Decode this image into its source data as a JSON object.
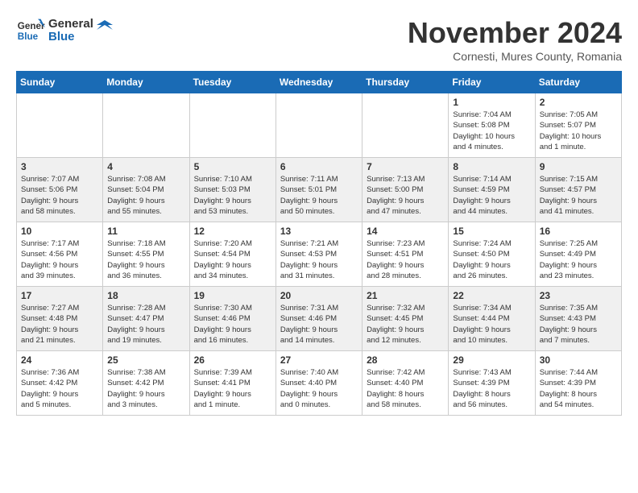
{
  "header": {
    "logo_line1": "General",
    "logo_line2": "Blue",
    "month_title": "November 2024",
    "subtitle": "Cornesti, Mures County, Romania"
  },
  "weekdays": [
    "Sunday",
    "Monday",
    "Tuesday",
    "Wednesday",
    "Thursday",
    "Friday",
    "Saturday"
  ],
  "weeks": [
    [
      {
        "day": "",
        "info": ""
      },
      {
        "day": "",
        "info": ""
      },
      {
        "day": "",
        "info": ""
      },
      {
        "day": "",
        "info": ""
      },
      {
        "day": "",
        "info": ""
      },
      {
        "day": "1",
        "info": "Sunrise: 7:04 AM\nSunset: 5:08 PM\nDaylight: 10 hours\nand 4 minutes."
      },
      {
        "day": "2",
        "info": "Sunrise: 7:05 AM\nSunset: 5:07 PM\nDaylight: 10 hours\nand 1 minute."
      }
    ],
    [
      {
        "day": "3",
        "info": "Sunrise: 7:07 AM\nSunset: 5:06 PM\nDaylight: 9 hours\nand 58 minutes."
      },
      {
        "day": "4",
        "info": "Sunrise: 7:08 AM\nSunset: 5:04 PM\nDaylight: 9 hours\nand 55 minutes."
      },
      {
        "day": "5",
        "info": "Sunrise: 7:10 AM\nSunset: 5:03 PM\nDaylight: 9 hours\nand 53 minutes."
      },
      {
        "day": "6",
        "info": "Sunrise: 7:11 AM\nSunset: 5:01 PM\nDaylight: 9 hours\nand 50 minutes."
      },
      {
        "day": "7",
        "info": "Sunrise: 7:13 AM\nSunset: 5:00 PM\nDaylight: 9 hours\nand 47 minutes."
      },
      {
        "day": "8",
        "info": "Sunrise: 7:14 AM\nSunset: 4:59 PM\nDaylight: 9 hours\nand 44 minutes."
      },
      {
        "day": "9",
        "info": "Sunrise: 7:15 AM\nSunset: 4:57 PM\nDaylight: 9 hours\nand 41 minutes."
      }
    ],
    [
      {
        "day": "10",
        "info": "Sunrise: 7:17 AM\nSunset: 4:56 PM\nDaylight: 9 hours\nand 39 minutes."
      },
      {
        "day": "11",
        "info": "Sunrise: 7:18 AM\nSunset: 4:55 PM\nDaylight: 9 hours\nand 36 minutes."
      },
      {
        "day": "12",
        "info": "Sunrise: 7:20 AM\nSunset: 4:54 PM\nDaylight: 9 hours\nand 34 minutes."
      },
      {
        "day": "13",
        "info": "Sunrise: 7:21 AM\nSunset: 4:53 PM\nDaylight: 9 hours\nand 31 minutes."
      },
      {
        "day": "14",
        "info": "Sunrise: 7:23 AM\nSunset: 4:51 PM\nDaylight: 9 hours\nand 28 minutes."
      },
      {
        "day": "15",
        "info": "Sunrise: 7:24 AM\nSunset: 4:50 PM\nDaylight: 9 hours\nand 26 minutes."
      },
      {
        "day": "16",
        "info": "Sunrise: 7:25 AM\nSunset: 4:49 PM\nDaylight: 9 hours\nand 23 minutes."
      }
    ],
    [
      {
        "day": "17",
        "info": "Sunrise: 7:27 AM\nSunset: 4:48 PM\nDaylight: 9 hours\nand 21 minutes."
      },
      {
        "day": "18",
        "info": "Sunrise: 7:28 AM\nSunset: 4:47 PM\nDaylight: 9 hours\nand 19 minutes."
      },
      {
        "day": "19",
        "info": "Sunrise: 7:30 AM\nSunset: 4:46 PM\nDaylight: 9 hours\nand 16 minutes."
      },
      {
        "day": "20",
        "info": "Sunrise: 7:31 AM\nSunset: 4:46 PM\nDaylight: 9 hours\nand 14 minutes."
      },
      {
        "day": "21",
        "info": "Sunrise: 7:32 AM\nSunset: 4:45 PM\nDaylight: 9 hours\nand 12 minutes."
      },
      {
        "day": "22",
        "info": "Sunrise: 7:34 AM\nSunset: 4:44 PM\nDaylight: 9 hours\nand 10 minutes."
      },
      {
        "day": "23",
        "info": "Sunrise: 7:35 AM\nSunset: 4:43 PM\nDaylight: 9 hours\nand 7 minutes."
      }
    ],
    [
      {
        "day": "24",
        "info": "Sunrise: 7:36 AM\nSunset: 4:42 PM\nDaylight: 9 hours\nand 5 minutes."
      },
      {
        "day": "25",
        "info": "Sunrise: 7:38 AM\nSunset: 4:42 PM\nDaylight: 9 hours\nand 3 minutes."
      },
      {
        "day": "26",
        "info": "Sunrise: 7:39 AM\nSunset: 4:41 PM\nDaylight: 9 hours\nand 1 minute."
      },
      {
        "day": "27",
        "info": "Sunrise: 7:40 AM\nSunset: 4:40 PM\nDaylight: 9 hours\nand 0 minutes."
      },
      {
        "day": "28",
        "info": "Sunrise: 7:42 AM\nSunset: 4:40 PM\nDaylight: 8 hours\nand 58 minutes."
      },
      {
        "day": "29",
        "info": "Sunrise: 7:43 AM\nSunset: 4:39 PM\nDaylight: 8 hours\nand 56 minutes."
      },
      {
        "day": "30",
        "info": "Sunrise: 7:44 AM\nSunset: 4:39 PM\nDaylight: 8 hours\nand 54 minutes."
      }
    ]
  ]
}
